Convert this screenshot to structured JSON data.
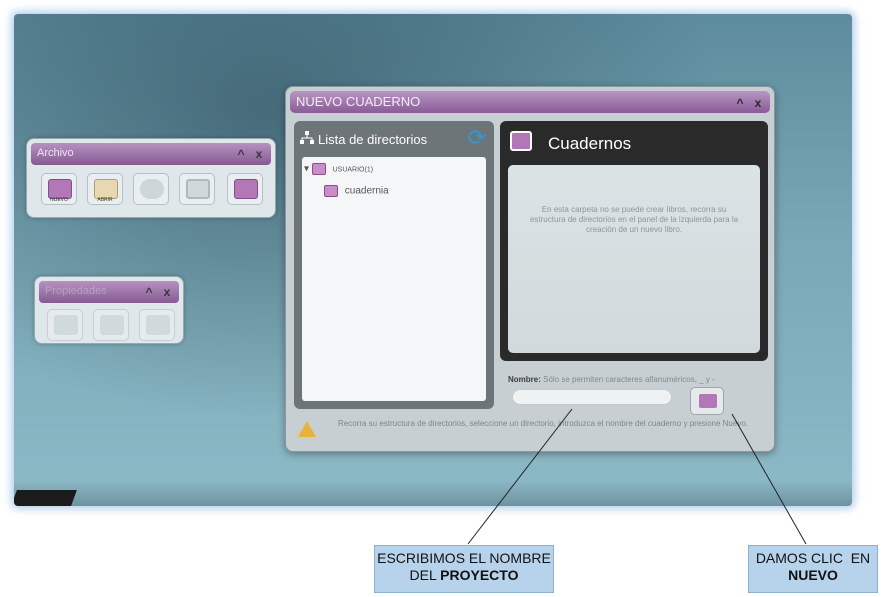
{
  "dialog": {
    "title": "NUEVO CUADERNO",
    "minimize_label": "^",
    "close_label": "x",
    "directories_title": "Lista de directorios",
    "tree": [
      {
        "label": "USUARIO(1)"
      },
      {
        "label": "cuadernia"
      }
    ],
    "notebooks_title": "Cuadernos",
    "notebooks_message": "En esta carpeta no se puede crear libros, recorra su estructura de directorios en el panel de la izquierda para la creación de un nuevo libro.",
    "name_label": "Nombre:",
    "name_hint": "Sólo se permiten caracteres alfanuméricos, _ y -",
    "name_value": "",
    "footer_text": "Recorra su estructura de directorios, seleccione un directorio, introduzca el nombre del cuaderno y presione Nuevo."
  },
  "archivo_palette": {
    "title": "Archivo",
    "tools": [
      {
        "caption": "NUEVO",
        "icon": "new-notebook-icon"
      },
      {
        "caption": "ABRIR",
        "icon": "open-icon"
      },
      {
        "caption": "",
        "icon": "link-icon"
      },
      {
        "caption": "",
        "icon": "save-icon"
      },
      {
        "caption": "",
        "icon": "delete-notebook-icon"
      }
    ]
  },
  "second_palette": {
    "title": "Propiedades",
    "tools": [
      {
        "icon": "properties-icon"
      },
      {
        "icon": "export-icon"
      },
      {
        "icon": "preview-icon"
      }
    ]
  },
  "callouts": {
    "left_line1": "ESCRIBIMOS EL NOMBRE",
    "left_line2_prefix": "DEL ",
    "left_line2_bold": "PROYECTO",
    "right_line1": "DAMOS CLIC  EN",
    "right_line2_bold": "NUEVO"
  },
  "colors": {
    "accent_purple": "#8a5b98",
    "callout_fill": "#b7d3ec",
    "warning": "#e8b23a"
  }
}
